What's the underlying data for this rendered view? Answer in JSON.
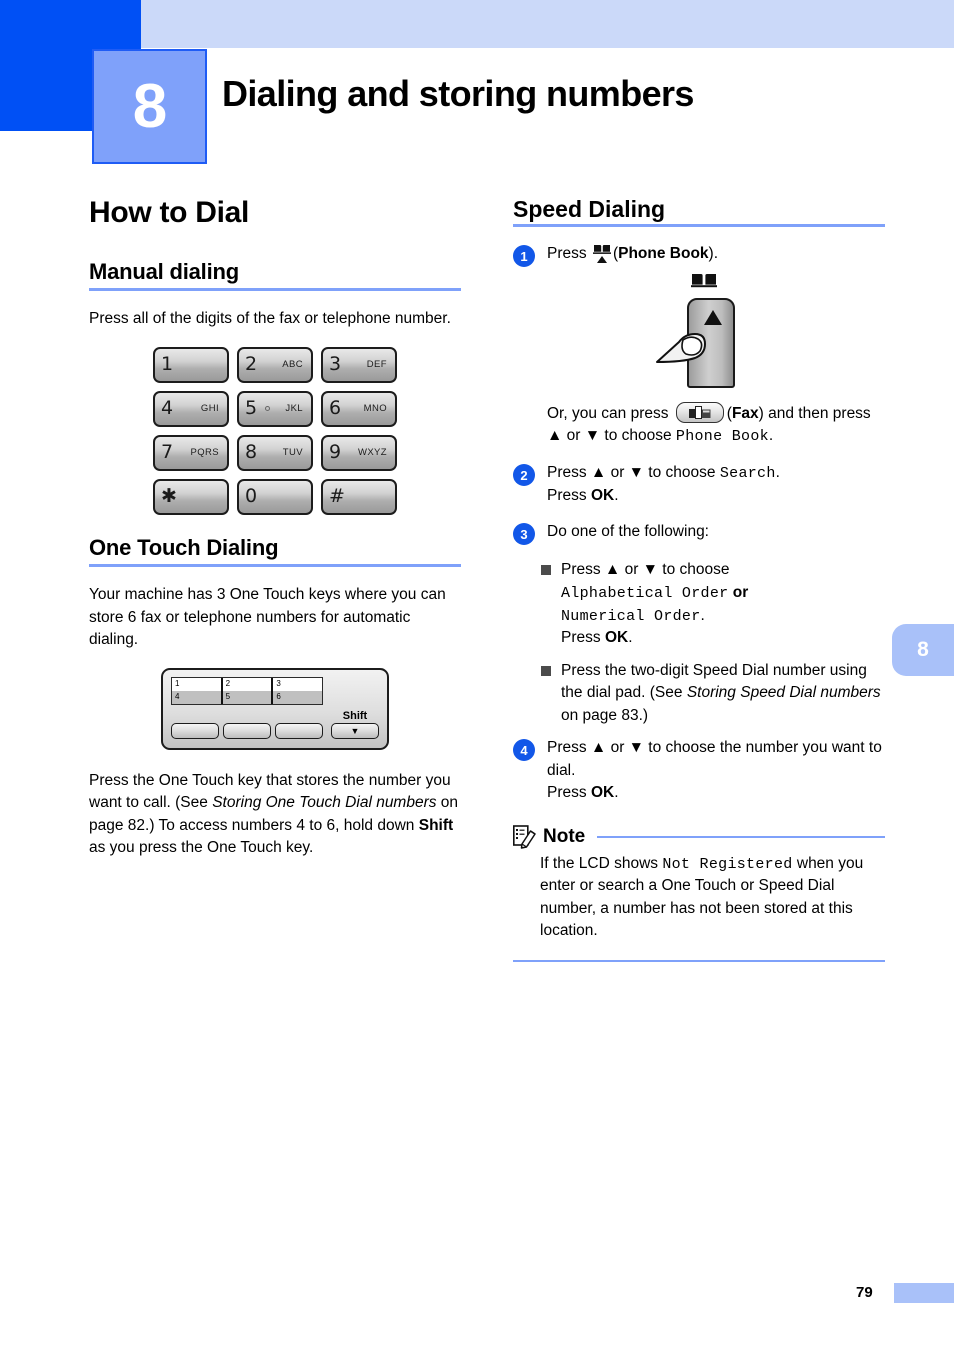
{
  "chapter": {
    "number": "8",
    "title": "Dialing and storing numbers",
    "side_tab_number": "8"
  },
  "footer": {
    "page_number": "79"
  },
  "left_column": {
    "section_title": "How to Dial",
    "manual_dialing": {
      "heading": "Manual dialing",
      "paragraph": "Press all of the digits of the fax or telephone number."
    },
    "dialpad": {
      "keys": [
        {
          "digit": "1",
          "letters": ""
        },
        {
          "digit": "2",
          "letters": "ABC"
        },
        {
          "digit": "3",
          "letters": "DEF"
        },
        {
          "digit": "4",
          "letters": "GHI"
        },
        {
          "digit": "5",
          "letters": "JKL"
        },
        {
          "digit": "6",
          "letters": "MNO"
        },
        {
          "digit": "7",
          "letters": "PQRS"
        },
        {
          "digit": "8",
          "letters": "TUV"
        },
        {
          "digit": "9",
          "letters": "WXYZ"
        },
        {
          "digit": "✱",
          "letters": ""
        },
        {
          "digit": "0",
          "letters": ""
        },
        {
          "digit": "#",
          "letters": ""
        }
      ]
    },
    "one_touch_dialing": {
      "heading": "One Touch Dialing",
      "paragraph": "Your machine has 3 One Touch keys where you can store 6 fax or telephone numbers for automatic dialing.",
      "panel": {
        "top_labels": [
          "1",
          "2",
          "3"
        ],
        "bottom_labels": [
          "4",
          "5",
          "6"
        ],
        "shift_label": "Shift",
        "shift_glyph": "▼"
      },
      "paragraph2_part1": "Press the One Touch key that stores the number you want to call. (See ",
      "paragraph2_italic": "Storing One Touch Dial numbers",
      "paragraph2_part2": " on page 82.) To access numbers 4 to 6, hold down ",
      "paragraph2_bold": "Shift",
      "paragraph2_part3": " as you press the One Touch key."
    }
  },
  "right_column": {
    "section_title": "Speed Dialing",
    "steps": [
      {
        "number": "1",
        "text_before": "Press ",
        "text_bold": "Phone Book",
        "text_after": ").",
        "paren_open": "(",
        "alt_line1_part1": "Or, you can press ",
        "alt_line1_bold": "Fax",
        "alt_line1_part2": ") and then press ▲ or ▼ to choose ",
        "alt_line1_mono": "Phone Book",
        "alt_line1_part3": "."
      },
      {
        "number": "2",
        "line1_before": "Press ▲ or ▼ to choose ",
        "line1_mono": "Search",
        "line1_after": ".",
        "line2_before": "Press ",
        "line2_bold": "OK",
        "line2_after": "."
      },
      {
        "number": "3",
        "text": "Do one of the following:"
      },
      {
        "number": "4",
        "line1": "Press ▲ or ▼ to choose the number you want to dial.",
        "line2_before": "Press ",
        "line2_bold": "OK",
        "line2_after": "."
      }
    ],
    "substeps": [
      {
        "line1": "Press ▲ or ▼ to choose",
        "mono1": "Alphabetical Order",
        "or_text": " or",
        "mono2": "Numerical Order",
        "mono2_after": ".",
        "line3_before": "Press ",
        "line3_bold": "OK",
        "line3_after": "."
      },
      {
        "text_part1": "Press the two-digit Speed Dial number using the dial pad. (See ",
        "text_italic": "Storing Speed Dial numbers",
        "text_part2": " on page 83.)"
      }
    ],
    "note": {
      "title": "Note",
      "body_part1": "If the LCD shows ",
      "body_mono": "Not Registered",
      "body_part2": " when you enter or search a One Touch or Speed Dial number, a number has not been stored at this location."
    }
  },
  "colors": {
    "header_dark_blue": "#0050f5",
    "header_light_blue": "#cbd9f9",
    "chapter_box_blue": "#7fa1fa",
    "rule_blue": "#7fa1fa",
    "step_circle_blue": "#1257e8",
    "tab_blue": "#a9c1f9"
  },
  "icons": {
    "phone_book": "phone-book-icon",
    "fax": "fax-icon",
    "note": "note-pencil-icon"
  }
}
